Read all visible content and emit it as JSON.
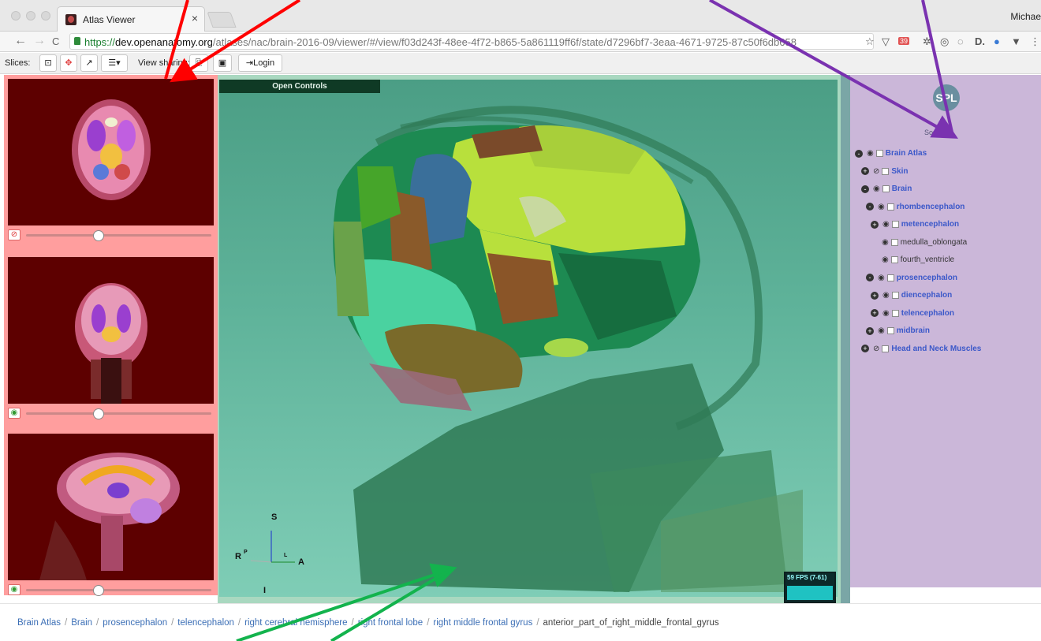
{
  "window": {
    "tab_title": "Atlas Viewer",
    "tab_close": "×",
    "profile_name": "Michae"
  },
  "address": {
    "url_scheme": "https://",
    "url_host": "dev.openanatomy.org",
    "url_path": "/atlases/nac/brain-2016-09/viewer/#/view/f03d243f-48ee-4f72-b865-5a861119ff6f/state/d7296bf7-3eaa-4671-9725-87c50f6db658",
    "back_glyph": "←",
    "forward_glyph": "→",
    "reload_glyph": "C",
    "badge": "39"
  },
  "toolbar": {
    "slices_label": "Slices:",
    "view_sharing_label": "View sharing:",
    "login_label": "Login"
  },
  "viewer": {
    "open_controls": "Open Controls",
    "fps": "59 FPS (7-61)",
    "axes": {
      "s": "S",
      "r": "R",
      "p": "P",
      "a": "A",
      "l": "L",
      "i": "I"
    }
  },
  "tree": {
    "logo_text": "SPL",
    "logo_caption": "Source",
    "items": [
      {
        "label": "Brain Atlas",
        "toggle": "-",
        "style": "link",
        "eye": "open"
      },
      {
        "label": "Skin",
        "toggle": "+",
        "style": "link",
        "eye": "hidden"
      },
      {
        "label": "Brain",
        "toggle": "-",
        "style": "link",
        "eye": "open"
      },
      {
        "label": "rhombencephalon",
        "toggle": "-",
        "style": "link",
        "eye": "open"
      },
      {
        "label": "metencephalon",
        "toggle": "+",
        "style": "link",
        "eye": "open"
      },
      {
        "label": "medulla_oblongata",
        "toggle": "",
        "style": "plain",
        "eye": "open"
      },
      {
        "label": "fourth_ventricle",
        "toggle": "",
        "style": "plain",
        "eye": "open"
      },
      {
        "label": "prosencephalon",
        "toggle": "-",
        "style": "link",
        "eye": "open"
      },
      {
        "label": "diencephalon",
        "toggle": "+",
        "style": "link",
        "eye": "open"
      },
      {
        "label": "telencephalon",
        "toggle": "+",
        "style": "link",
        "eye": "open"
      },
      {
        "label": "midbrain",
        "toggle": "+",
        "style": "link",
        "eye": "open"
      },
      {
        "label": "Head and Neck Muscles",
        "toggle": "+",
        "style": "link",
        "eye": "hidden"
      }
    ]
  },
  "breadcrumb": [
    "Brain Atlas",
    "Brain",
    "prosencephalon",
    "telencephalon",
    "right cerebral hemisphere",
    "right frontal lobe",
    "right middle frontal gyrus",
    "anterior_part_of_right_middle_frontal_gyrus"
  ],
  "slices": [
    {
      "name": "axial",
      "slider_value": 0.39
    },
    {
      "name": "coronal",
      "slider_value": 0.39
    },
    {
      "name": "sagittal",
      "slider_value": 0.39
    }
  ],
  "colors": {
    "left_highlight": "#ff9e9e",
    "right_highlight": "#cbb7d9",
    "viewer_highlight": "#a9d8c0",
    "arrow_red": "#ff0000",
    "arrow_purple": "#7a32b0",
    "arrow_green": "#13b34d"
  }
}
